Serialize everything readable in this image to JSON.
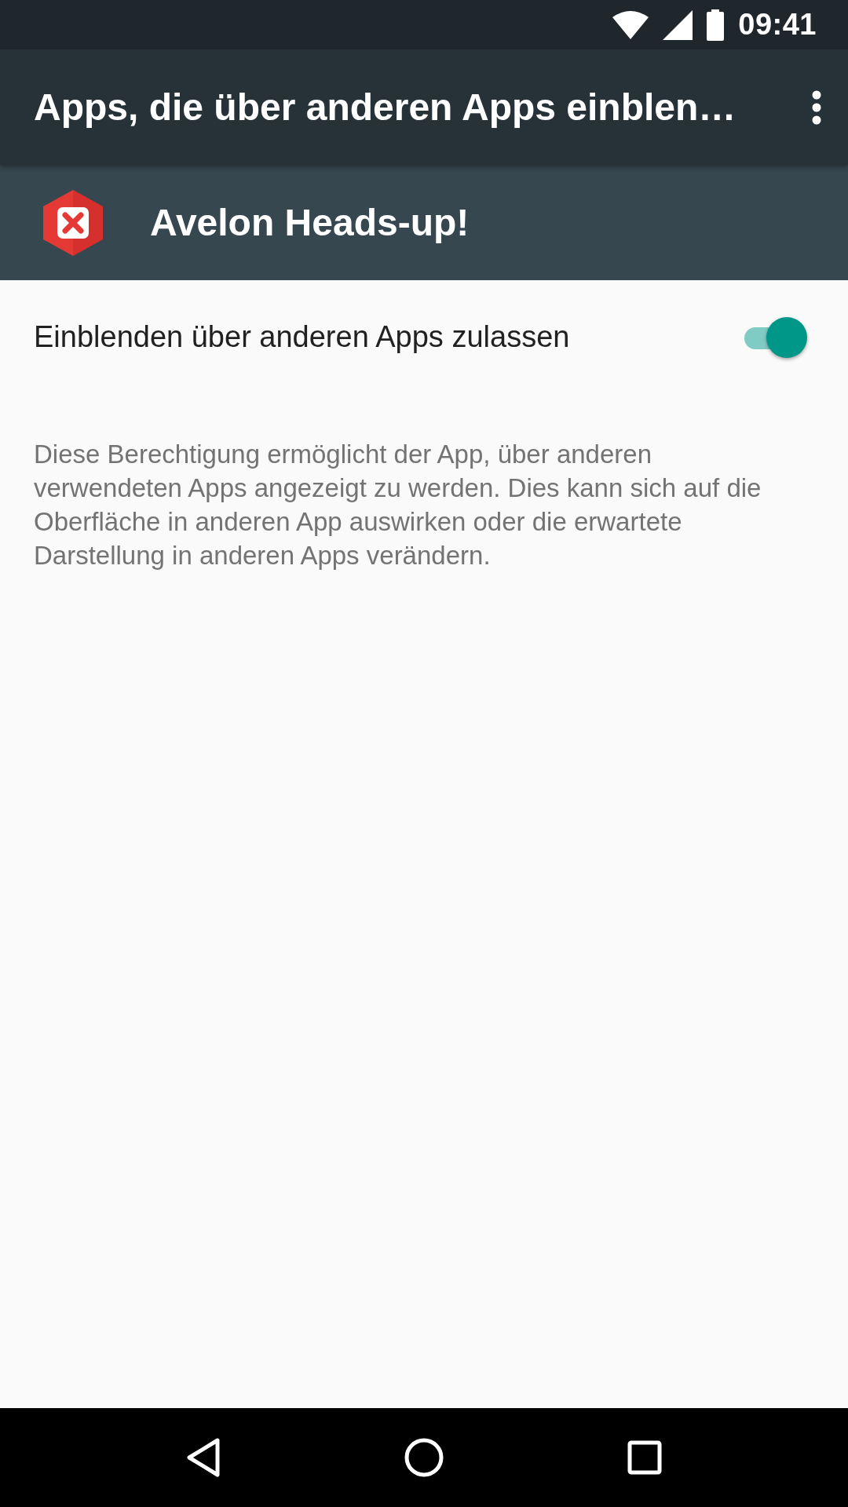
{
  "status_bar": {
    "time": "09:41"
  },
  "toolbar": {
    "title": "Apps, die über anderen Apps einblen…"
  },
  "app": {
    "name": "Avelon Heads-up!"
  },
  "setting": {
    "label": "Einblenden über anderen Apps zulassen",
    "on": true
  },
  "description": "Diese Berechtigung ermöglicht der App, über anderen verwendeten Apps angezeigt zu werden. Dies kann sich auf die Oberfläche in anderen App auswirken oder die erwartete Darstellung in anderen Apps verändern."
}
